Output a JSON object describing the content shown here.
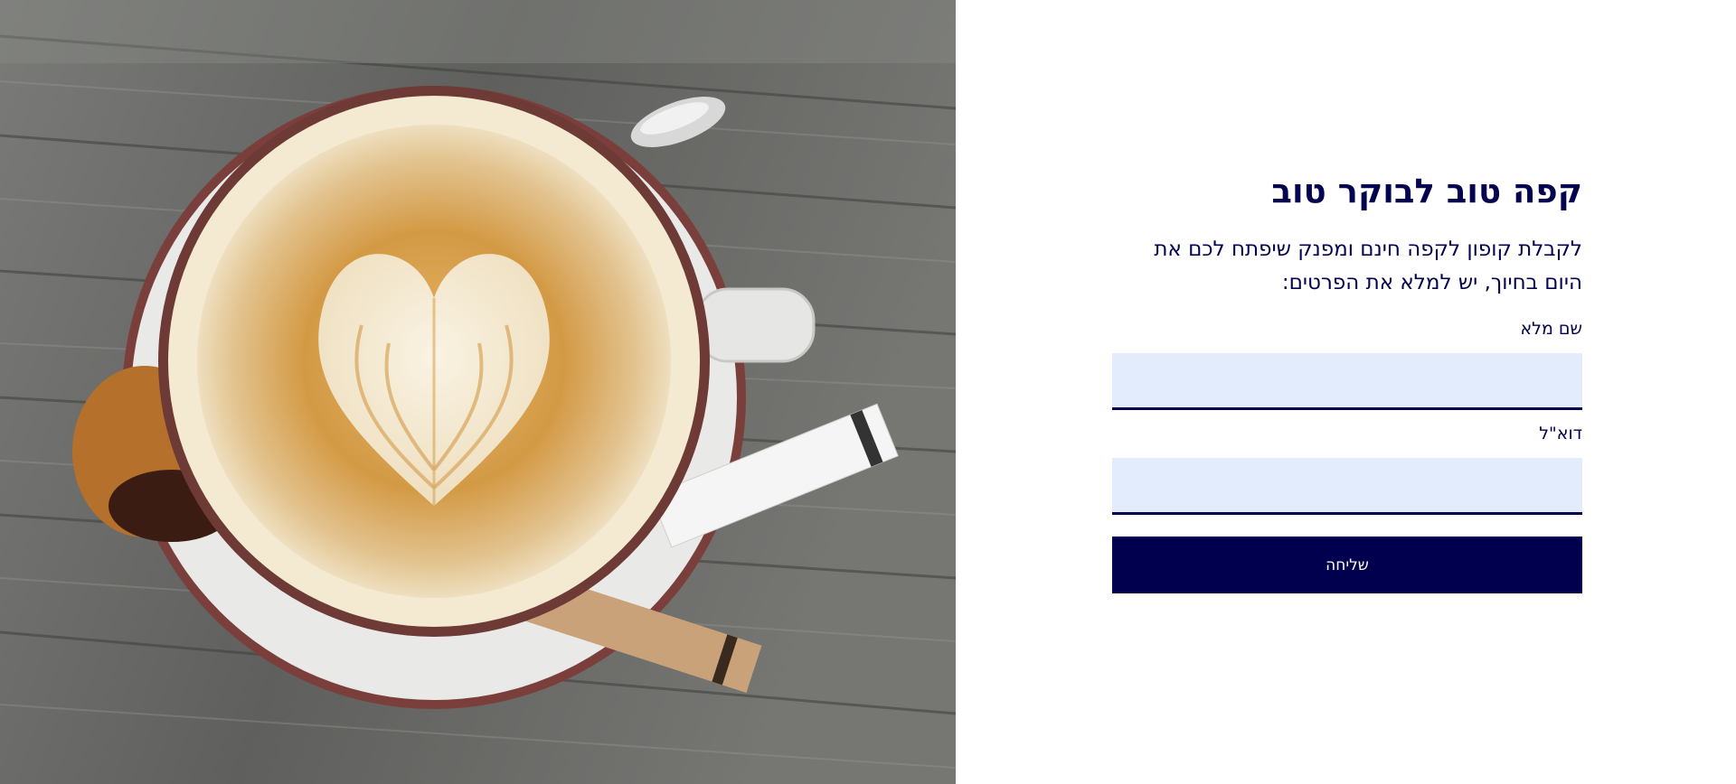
{
  "hero": {
    "image": "coffee-latte-photo",
    "colors": {
      "wood": "#6b6c6a",
      "cup_rim": "#6e3a35",
      "crema": "#c98d3a",
      "foam": "#f4ead2"
    }
  },
  "form": {
    "title": "קפה טוב לבוקר טוב",
    "lead": "לקבלת קופון לקפה חינם ומפנק שיפתח לכם את היום בחיוך, יש למלא את הפרטים:",
    "name_label": "שם מלא",
    "name_value": "",
    "email_label": "דוא\"ל",
    "email_value": "",
    "submit_label": "שליחה"
  },
  "colors": {
    "text": "#03034f",
    "input_bg": "#e3ecfd",
    "button_bg": "#00004f",
    "button_text": "#ffffff"
  }
}
